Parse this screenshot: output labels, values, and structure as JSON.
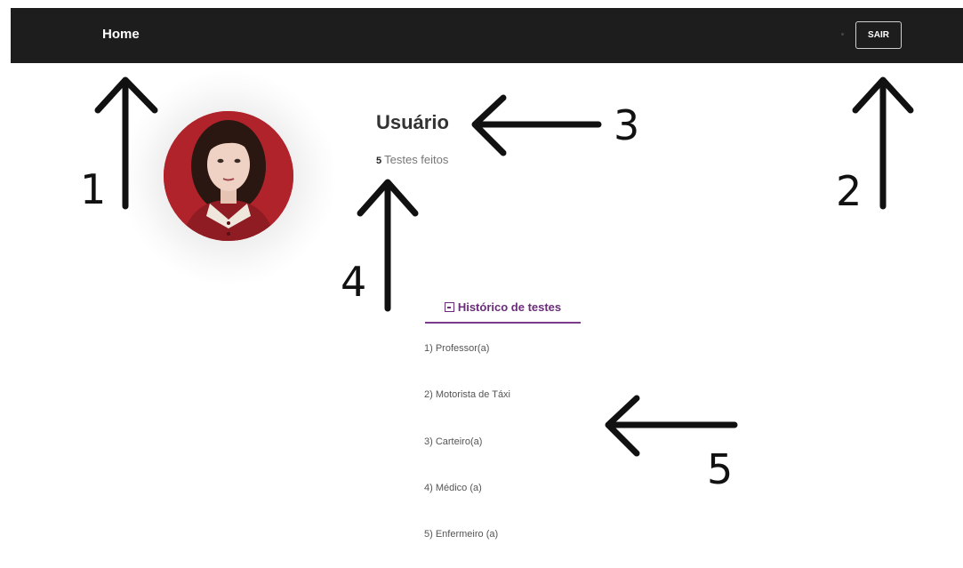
{
  "navbar": {
    "home_label": "Home",
    "logout_label": "SAIR"
  },
  "profile": {
    "username": "Usuário",
    "tests_done_count": "5",
    "tests_done_label": "Testes feitos"
  },
  "tabs": {
    "history_label": "Histórico de testes"
  },
  "history": {
    "items": [
      "1) Professor(a)",
      "2) Motorista de Táxi",
      "3) Carteiro(a)",
      "4) Médico (a)",
      "5) Enfermeiro (a)"
    ]
  },
  "annotations": [
    "1",
    "2",
    "3",
    "4",
    "5"
  ],
  "colors": {
    "navbar_bg": "#1d1d1d",
    "accent": "#6b2c7a",
    "avatar_bg": "#b5262c"
  },
  "icons": {
    "history_tab": "contact-card-icon",
    "avatar": "profile-photo"
  }
}
